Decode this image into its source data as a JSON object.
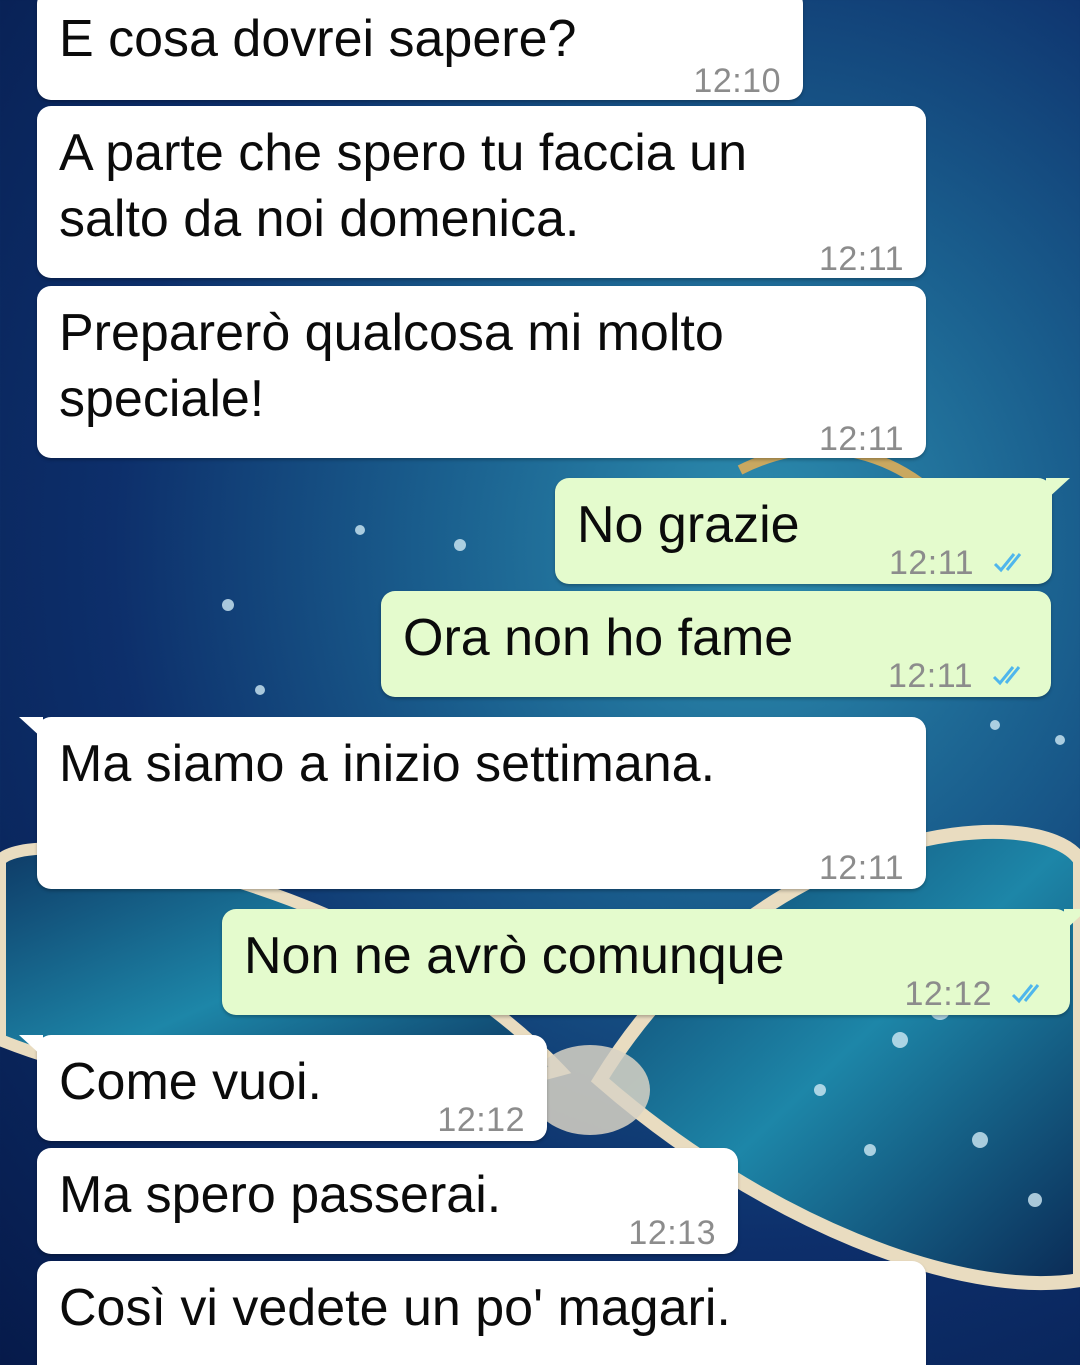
{
  "messages": [
    {
      "text": "E cosa dovrei sapere?",
      "time": "12:10"
    },
    {
      "text": "A parte che spero tu faccia un\nsalto da noi domenica.",
      "time": "12:11"
    },
    {
      "text": "Preparerò qualcosa mi molto\nspeciale!",
      "time": "12:11"
    },
    {
      "text": "No grazie",
      "time": "12:11",
      "status": "read"
    },
    {
      "text": "Ora non ho fame",
      "time": "12:11",
      "status": "read"
    },
    {
      "text": "Ma siamo a inizio settimana.",
      "time": "12:11"
    },
    {
      "text": "Non ne avrò comunque",
      "time": "12:12",
      "status": "read"
    },
    {
      "text": "Come vuoi.",
      "time": "12:12"
    },
    {
      "text": "Ma spero passerai.",
      "time": "12:13"
    },
    {
      "text": "Così vi vedete un po' magari.",
      "time": ""
    }
  ],
  "colors": {
    "incoming_bubble": "#ffffff",
    "outgoing_bubble": "#e4fbcd",
    "timestamp": "#8c8c8c",
    "read_ticks": "#4fb6ec"
  },
  "icons": {
    "read_receipt": "double-check-icon"
  }
}
